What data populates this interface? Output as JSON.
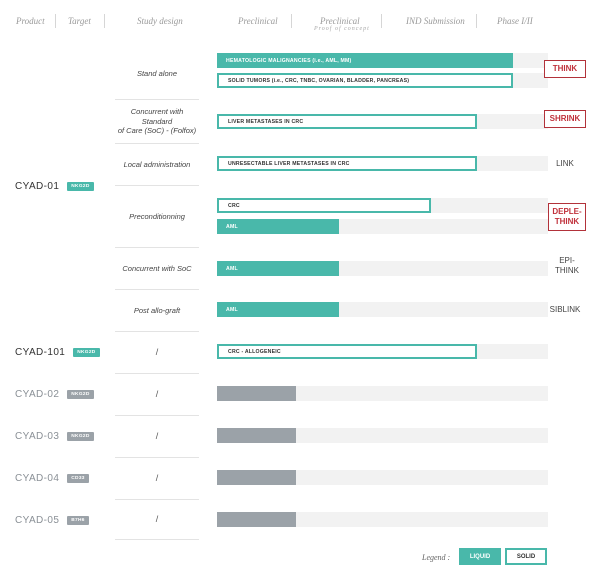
{
  "columns": {
    "product": "Product",
    "target": "Target",
    "study_design": "Study design",
    "preclinical": "Preclinical",
    "preclinical_poc": "Preclinical",
    "preclinical_poc_sub": "Proof of concept",
    "ind": "IND Submission",
    "phase": "Phase I/II"
  },
  "products": {
    "cyad01": {
      "name": "CYAD-01",
      "target": "NKG2D"
    },
    "cyad101": {
      "name": "CYAD-101",
      "target": "NKG2D"
    },
    "cyad02": {
      "name": "CYAD-02",
      "target": "NKG2D"
    },
    "cyad03": {
      "name": "CYAD-03",
      "target": "NKG2D"
    },
    "cyad04": {
      "name": "CYAD-04",
      "target": "CD33"
    },
    "cyad05": {
      "name": "CYAD-05",
      "target": "B7H6"
    }
  },
  "designs": {
    "stand_alone": "Stand alone",
    "concurrent_soc_1": "Concurrent with Standard",
    "concurrent_soc_2": "of Care (SoC) - (Folfox)",
    "local_admin": "Local administration",
    "preconditioning": "Preconditionning",
    "concurrent_soc": "Concurrent with SoC",
    "post_allo": "Post allo-graft",
    "slash": "/"
  },
  "bars": {
    "heme": "HEMATOLOGIC MALIGNANCIES (i.e., AML, MM)",
    "solid": "SOLID TUMORS (i.e., CRC, TNBC, OVARIAN, BLADDER, PANCREAS)",
    "liver_crc": "LIVER METASTASES IN CRC",
    "unresectable": "UNRESECTABLE LIVER METASTASES IN CRC",
    "crc": "CRC",
    "aml": "AML",
    "crc_allo": "CRC - ALLOGENEIC"
  },
  "trials": {
    "think": "THINK",
    "shrink": "SHRINK",
    "link": "LINK",
    "deplethink_1": "DEPLE-",
    "deplethink_2": "THINK",
    "epithink_1": "EPI-",
    "epithink_2": "THINK",
    "siblink": "SIBLINK"
  },
  "legend": {
    "title": "Legend :",
    "liquid": "LIQUID",
    "solid": "SOLID"
  },
  "colors": {
    "liquid": "#49b8aa",
    "inactive": "#9ba2a8",
    "highlight": "#c0313b"
  }
}
